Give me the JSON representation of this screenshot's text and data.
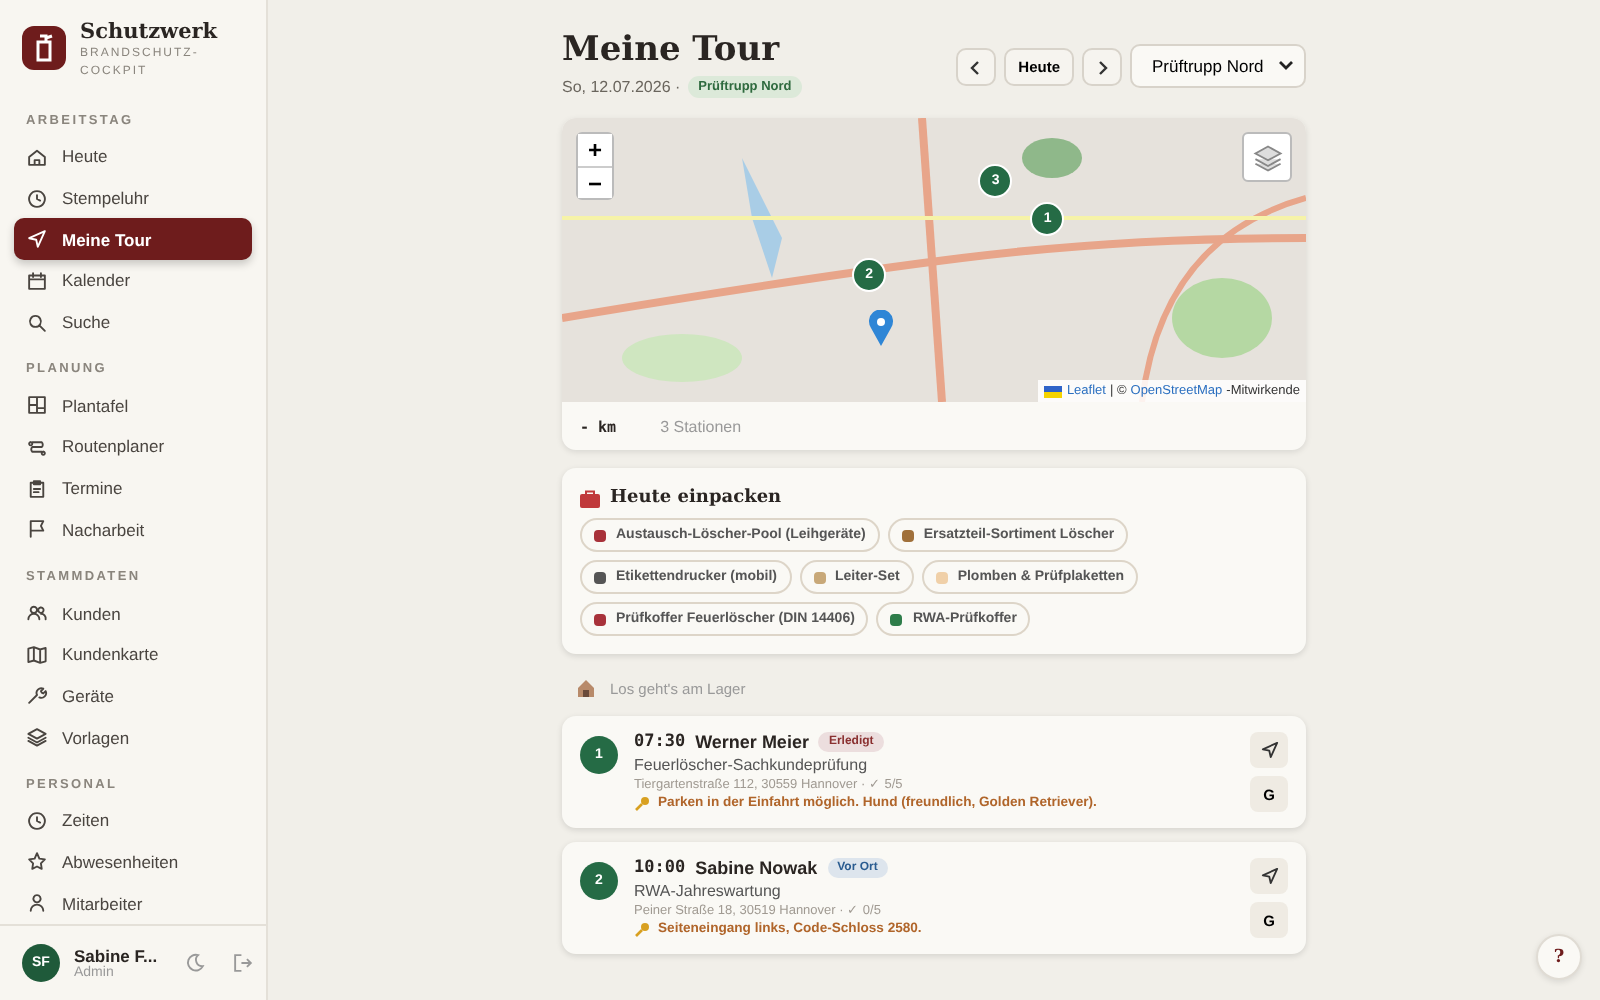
{
  "brand": {
    "name": "Schutzwerk",
    "subtitle": "BRANDSCHUTZ-\nCOCKPIT"
  },
  "sidebar": {
    "sections": [
      {
        "title": "ARBEITSTAG",
        "items": [
          {
            "label": "Heute",
            "selected": false
          },
          {
            "label": "Stempeluhr",
            "selected": false
          },
          {
            "label": "Meine Tour",
            "selected": true
          },
          {
            "label": "Kalender",
            "selected": false
          },
          {
            "label": "Suche",
            "selected": false
          }
        ]
      },
      {
        "title": "PLANUNG",
        "items": [
          {
            "label": "Plantafel",
            "selected": false
          },
          {
            "label": "Routenplaner",
            "selected": false
          },
          {
            "label": "Termine",
            "selected": false
          },
          {
            "label": "Nacharbeit",
            "selected": false
          }
        ]
      },
      {
        "title": "STAMMDATEN",
        "items": [
          {
            "label": "Kunden",
            "selected": false
          },
          {
            "label": "Kundenkarte",
            "selected": false
          },
          {
            "label": "Geräte",
            "selected": false
          },
          {
            "label": "Vorlagen",
            "selected": false
          }
        ]
      },
      {
        "title": "PERSONAL",
        "items": [
          {
            "label": "Zeiten",
            "selected": false
          },
          {
            "label": "Abwesenheiten",
            "selected": false
          },
          {
            "label": "Mitarbeiter",
            "selected": false
          }
        ]
      }
    ]
  },
  "user": {
    "initials": "SF",
    "name": "Sabine F...",
    "role": "Admin"
  },
  "header": {
    "title": "Meine Tour",
    "date": "So, 12.07.2026 ·",
    "team": "Prüftrupp Nord",
    "today_button": "Heute",
    "team_select": "Prüftrupp Nord"
  },
  "map": {
    "zoom_in": "+",
    "zoom_out": "−",
    "markers": [
      {
        "label": "3"
      },
      {
        "label": "1"
      },
      {
        "label": "2"
      }
    ],
    "attribution_link": "Leaflet",
    "attribution_sep": "| ©",
    "attribution_osm": "OpenStreetMap",
    "attribution_rest": "-Mitwirkende",
    "distance": "- km",
    "stations": "3 Stationen"
  },
  "pack": {
    "title": "Heute einpacken",
    "items": [
      {
        "label": "Austausch-Löscher-Pool (Leihgeräte)",
        "color": "#a8323a"
      },
      {
        "label": "Ersatzteil-Sortiment Löscher",
        "color": "#a0703a"
      },
      {
        "label": "Etikettendrucker (mobil)",
        "color": "#555555"
      },
      {
        "label": "Leiter-Set",
        "color": "#c8a878"
      },
      {
        "label": "Plomben & Prüfplaketten",
        "color": "#f0d0a8"
      },
      {
        "label": "Prüfkoffer Feuerlöscher (DIN 14406)",
        "color": "#a8323a"
      },
      {
        "label": "RWA-Prüfkoffer",
        "color": "#2e7d4a"
      }
    ]
  },
  "start": "Los geht's am Lager",
  "stops": [
    {
      "number": "1",
      "time": "07:30",
      "name": "Werner Meier",
      "status": {
        "label": "Erledigt",
        "color": "#8a3030"
      },
      "service": "Feuerlöscher-Sachkundeprüfung",
      "address": "Tiergartenstraße 112, 30559 Hannover · ✓ 5/5",
      "note": "Parken in der Einfahrt möglich. Hund (freundlich, Golden Retriever).",
      "g_button": "G"
    },
    {
      "number": "2",
      "time": "10:00",
      "name": "Sabine Nowak",
      "status": {
        "label": "Vor Ort",
        "color": "#2a5c90"
      },
      "service": "RWA-Jahreswartung",
      "address": "Peiner Straße 18, 30519 Hannover · ✓ 0/5",
      "note": "Seiteneingang links, Code-Schloss 2580.",
      "g_button": "G"
    }
  ],
  "help": "?"
}
